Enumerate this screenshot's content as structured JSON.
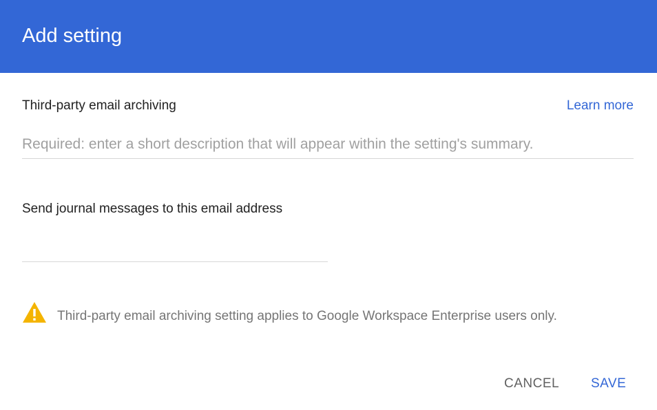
{
  "dialog": {
    "title": "Add setting"
  },
  "setting": {
    "name": "Third-party email archiving",
    "learn_more": "Learn more",
    "description_placeholder": "Required: enter a short description that will appear within the setting's summary.",
    "description_value": ""
  },
  "journal": {
    "label": "Send journal messages to this email address",
    "email_value": ""
  },
  "warning": {
    "icon": "warning-triangle-icon",
    "text": "Third-party email archiving setting applies to Google Workspace Enterprise users only."
  },
  "actions": {
    "cancel_label": "CANCEL",
    "save_label": "SAVE"
  },
  "colors": {
    "header": "#3367d6",
    "accent": "#3367d6",
    "warning": "#f4b400"
  }
}
